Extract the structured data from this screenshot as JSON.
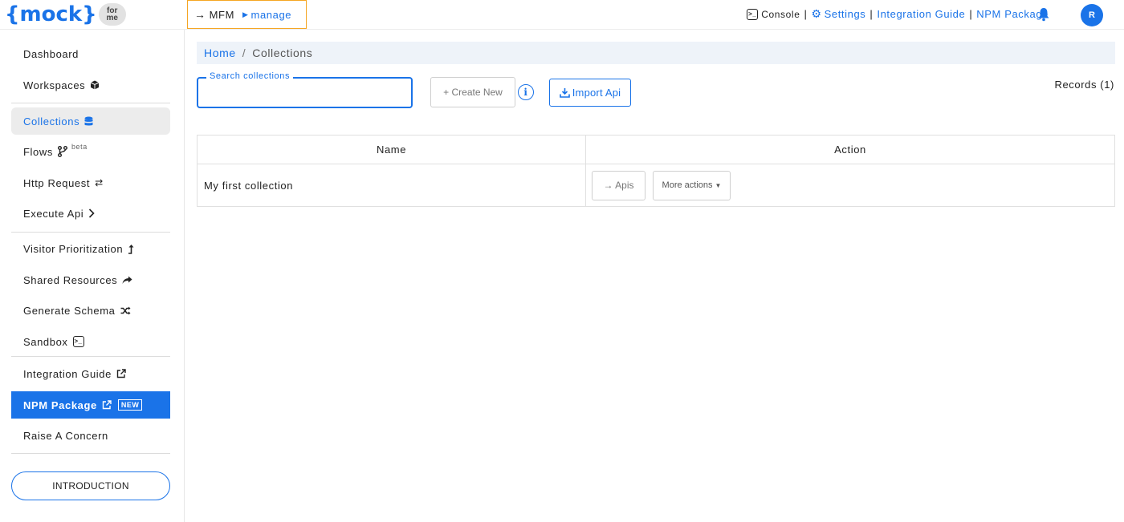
{
  "logo": {
    "text": "{mock}",
    "badge_top": "for",
    "badge_bottom": "me"
  },
  "header": {
    "mfm_label": "MFM",
    "manage_label": "manage",
    "console_label": "Console",
    "settings_label": "Settings",
    "integration_guide_label": "Integration Guide",
    "npm_package_label": "NPM Package",
    "separator": "|",
    "avatar_initial": "R"
  },
  "sidebar": {
    "items": [
      {
        "label": "Dashboard"
      },
      {
        "label": "Workspaces"
      },
      {
        "label": "Collections"
      },
      {
        "label": "Flows",
        "tag": "beta"
      },
      {
        "label": "Http Request"
      },
      {
        "label": "Execute Api"
      },
      {
        "label": "Visitor Prioritization"
      },
      {
        "label": "Shared Resources"
      },
      {
        "label": "Generate Schema"
      },
      {
        "label": "Sandbox"
      },
      {
        "label": "Integration Guide"
      },
      {
        "label": "NPM Package",
        "badge": "NEW"
      },
      {
        "label": "Raise A Concern"
      }
    ],
    "intro_button": "INTRODUCTION"
  },
  "breadcrumb": {
    "home": "Home",
    "separator": "/",
    "current": "Collections"
  },
  "toolbar": {
    "search_label": "Search collections",
    "search_value": "",
    "create_new": "+ Create New",
    "info": "i",
    "import_api": "Import Api",
    "records": "Records (1)"
  },
  "table": {
    "headers": [
      "Name",
      "Action"
    ],
    "rows": [
      {
        "name": "My first collection",
        "apis_label": "→ Apis",
        "more_label": "More actions"
      }
    ]
  },
  "colors": {
    "accent": "#1a73e8",
    "highlight_border": "#f5a623",
    "active_bg": "#ececec",
    "breadcrumb_bg": "#eef3f9"
  },
  "icons": {
    "workspaces": "cube-icon",
    "collections": "database-icon",
    "flows": "branch-icon",
    "http": "exchange-icon",
    "execute": "chevron-right-icon",
    "visitor": "level-up-icon",
    "shared": "share-icon",
    "schema": "shuffle-icon",
    "sandbox": "terminal-icon",
    "external": "external-link-icon",
    "bell": "bell-icon",
    "settings": "gear-icon"
  }
}
